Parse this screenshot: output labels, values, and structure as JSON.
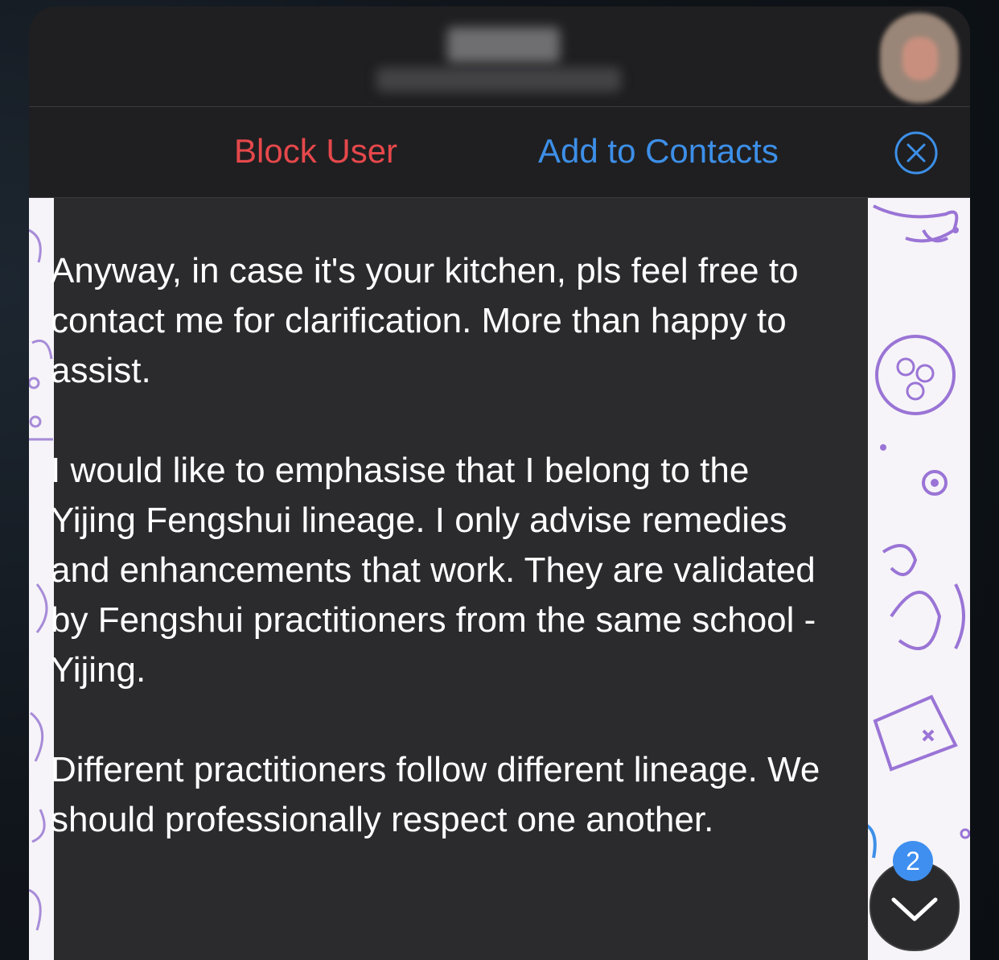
{
  "header": {
    "contact_name": "",
    "contact_status": ""
  },
  "action_bar": {
    "block_label": "Block User",
    "add_label": "Add to Contacts",
    "close_icon": "close-circle-icon"
  },
  "message": {
    "paragraphs": [
      "Anyway, in case it's your kitchen, pls feel free to contact me for clarification. More than happy to assist.",
      "I would like to emphasise that I belong to the Yijing Fengshui lineage. I only advise remedies and enhancements that work. They are validated by Fengshui practitioners from the same school - Yijing.",
      "Different practitioners follow different lineage. We should professionally respect one another."
    ]
  },
  "scroll_down": {
    "unread_count": "2",
    "icon": "chevron-down-icon"
  },
  "colors": {
    "block": "#e6484b",
    "accent": "#3d8fe8",
    "bubble": "#2b2b2e"
  }
}
